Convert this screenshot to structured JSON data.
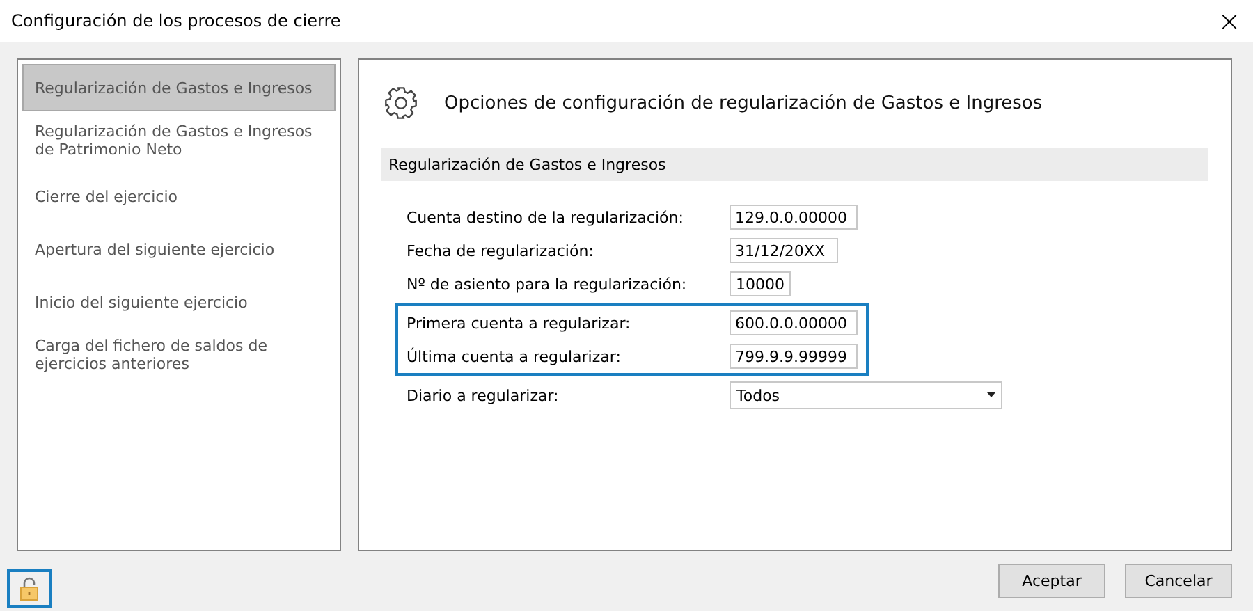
{
  "window": {
    "title": "Configuración de los procesos de cierre",
    "close": "×"
  },
  "sidebar": {
    "items": [
      {
        "label": "Regularización de Gastos e Ingresos",
        "selected": true
      },
      {
        "label": "Regularización de Gastos e Ingresos de Patrimonio Neto",
        "selected": false
      },
      {
        "label": "Cierre del ejercicio",
        "selected": false
      },
      {
        "label": "Apertura del siguiente ejercicio",
        "selected": false
      },
      {
        "label": "Inicio del siguiente ejercicio",
        "selected": false
      },
      {
        "label": "Carga del fichero de saldos de ejercicios anteriores",
        "selected": false
      }
    ]
  },
  "content": {
    "heading": "Opciones de configuración de regularización de Gastos e Ingresos",
    "section": "Regularización de Gastos e Ingresos",
    "field_groups": [
      {
        "highlighted": false,
        "fields": [
          {
            "kind": "account",
            "label": "Cuenta destino de la regularización:",
            "value": "129.0.0.00000"
          },
          {
            "kind": "date",
            "label": "Fecha de regularización:",
            "value": "31/12/20XX"
          },
          {
            "kind": "number",
            "label": "Nº de asiento para la regularización:",
            "value": "10000"
          }
        ]
      },
      {
        "highlighted": true,
        "fields": [
          {
            "kind": "account",
            "label": "Primera cuenta a regularizar:",
            "value": "600.0.0.00000"
          },
          {
            "kind": "account",
            "label": "Última cuenta a regularizar:",
            "value": "799.9.9.99999"
          }
        ]
      },
      {
        "highlighted": false,
        "fields": [
          {
            "kind": "dropdown",
            "label": "Diario a regularizar:",
            "value": "Todos"
          }
        ]
      }
    ]
  },
  "buttons": [
    "Aceptar",
    "Cancelar"
  ]
}
